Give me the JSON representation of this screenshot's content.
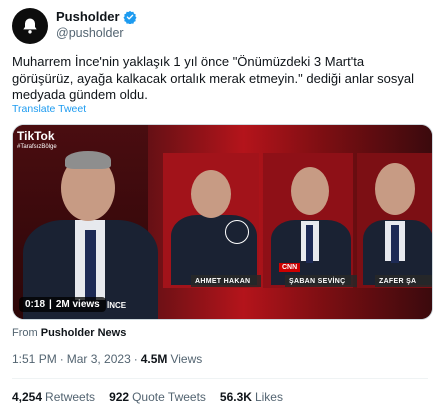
{
  "author": {
    "display_name": "Pusholder",
    "handle": "@pusholder",
    "avatar_icon": "bell-icon",
    "verified": true,
    "verified_color": "#1d9bf0"
  },
  "tweet": {
    "text": "Muharrem İnce'nin yaklaşık 1 yıl önce \"Önümüzdeki 3 Mart'ta görüşürüz, ayağa kalkacak ortalık merak etmeyin.\" dediği anlar sosyal medyada gündem oldu.",
    "translate_label": "Translate Tweet"
  },
  "media": {
    "tiktok_logo": "TikTok",
    "tiktok_user": "#TarafsızBölge",
    "duration": "0:18",
    "views_label": "2M views",
    "speaker_label": "İNCE",
    "panel_names": [
      "AHMET HAKAN",
      "ŞABAN SEVİNÇ",
      "ZAFER ŞA"
    ],
    "channel_logo": "CNN"
  },
  "source": {
    "prefix": "From",
    "name": "Pusholder News"
  },
  "meta": {
    "time": "1:51 PM",
    "date": "Mar 3, 2023",
    "views_count": "4.5M",
    "views_label": "Views",
    "separator": "·"
  },
  "stats": {
    "retweets_count": "4,254",
    "retweets_label": "Retweets",
    "quotes_count": "922",
    "quotes_label": "Quote Tweets",
    "likes_count": "56.3K",
    "likes_label": "Likes"
  },
  "colors": {
    "link": "#1d9bf0",
    "secondary_text": "#536471",
    "primary_text": "#0f1419"
  }
}
